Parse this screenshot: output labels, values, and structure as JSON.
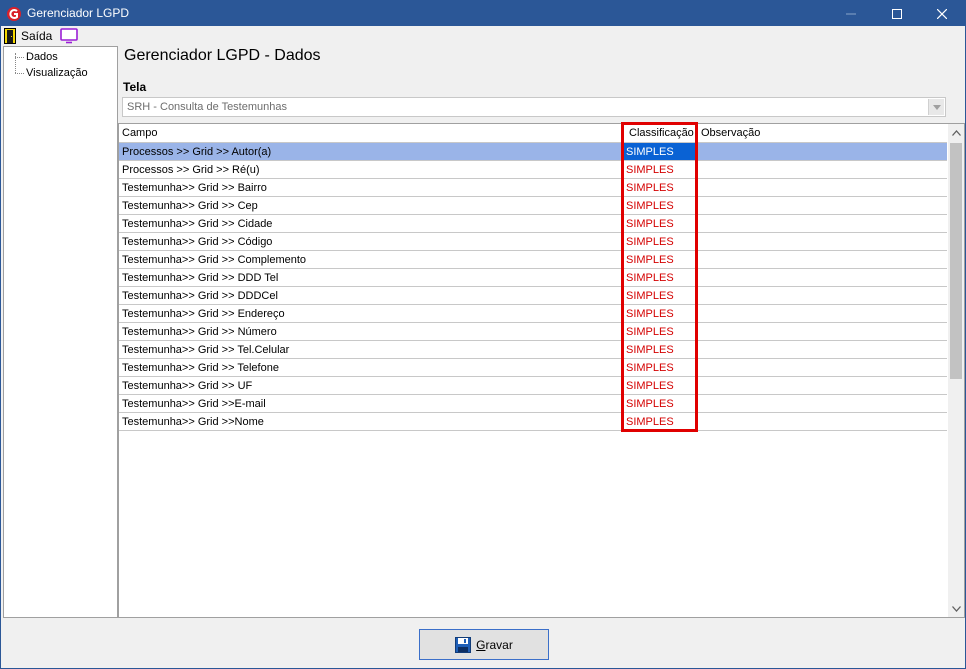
{
  "window": {
    "title": "Gerenciador LGPD",
    "controls": {
      "minimize": "minimize-icon",
      "maximize": "maximize-icon",
      "close": "close-icon"
    }
  },
  "menu": {
    "exit_label": "Saída",
    "exit_icon": "exit-door-icon",
    "screen_icon": "monitor-icon"
  },
  "tree": {
    "items": [
      {
        "label": "Dados"
      },
      {
        "label": "Visualização"
      }
    ]
  },
  "main": {
    "heading": "Gerenciador LGPD - Dados",
    "tela_label": "Tela",
    "tela_value": "SRH - Consulta de Testemunhas"
  },
  "grid": {
    "columns": [
      "Campo",
      "Classificação",
      "Observação"
    ],
    "rows": [
      {
        "campo": "Processos >> Grid >> Autor(a)",
        "classificacao": "SIMPLES",
        "observacao": "",
        "selected": true
      },
      {
        "campo": "Processos >> Grid >> Ré(u)",
        "classificacao": "SIMPLES",
        "observacao": ""
      },
      {
        "campo": "Testemunha>> Grid >> Bairro",
        "classificacao": "SIMPLES",
        "observacao": ""
      },
      {
        "campo": "Testemunha>> Grid >> Cep",
        "classificacao": "SIMPLES",
        "observacao": ""
      },
      {
        "campo": "Testemunha>> Grid >> Cidade",
        "classificacao": "SIMPLES",
        "observacao": ""
      },
      {
        "campo": "Testemunha>> Grid >> Código",
        "classificacao": "SIMPLES",
        "observacao": ""
      },
      {
        "campo": "Testemunha>> Grid >> Complemento",
        "classificacao": "SIMPLES",
        "observacao": ""
      },
      {
        "campo": "Testemunha>> Grid >> DDD Tel",
        "classificacao": "SIMPLES",
        "observacao": ""
      },
      {
        "campo": "Testemunha>> Grid >> DDDCel",
        "classificacao": "SIMPLES",
        "observacao": ""
      },
      {
        "campo": "Testemunha>> Grid >> Endereço",
        "classificacao": "SIMPLES",
        "observacao": ""
      },
      {
        "campo": "Testemunha>> Grid >> Número",
        "classificacao": "SIMPLES",
        "observacao": ""
      },
      {
        "campo": "Testemunha>> Grid >> Tel.Celular",
        "classificacao": "SIMPLES",
        "observacao": ""
      },
      {
        "campo": "Testemunha>> Grid >> Telefone",
        "classificacao": "SIMPLES",
        "observacao": ""
      },
      {
        "campo": "Testemunha>> Grid >> UF",
        "classificacao": "SIMPLES",
        "observacao": ""
      },
      {
        "campo": "Testemunha>> Grid >>E-mail",
        "classificacao": "SIMPLES",
        "observacao": ""
      },
      {
        "campo": "Testemunha>> Grid >>Nome",
        "classificacao": "SIMPLES",
        "observacao": ""
      }
    ]
  },
  "footer": {
    "save_label_accel": "G",
    "save_label_rest": "ravar",
    "save_icon": "floppy-disk-icon"
  },
  "colors": {
    "titlebar": "#2b5797",
    "selected_row": "#9ab4e8",
    "selected_cell": "#0a62d4",
    "classification_text": "#d40000",
    "highlight_box": "#e00000"
  }
}
